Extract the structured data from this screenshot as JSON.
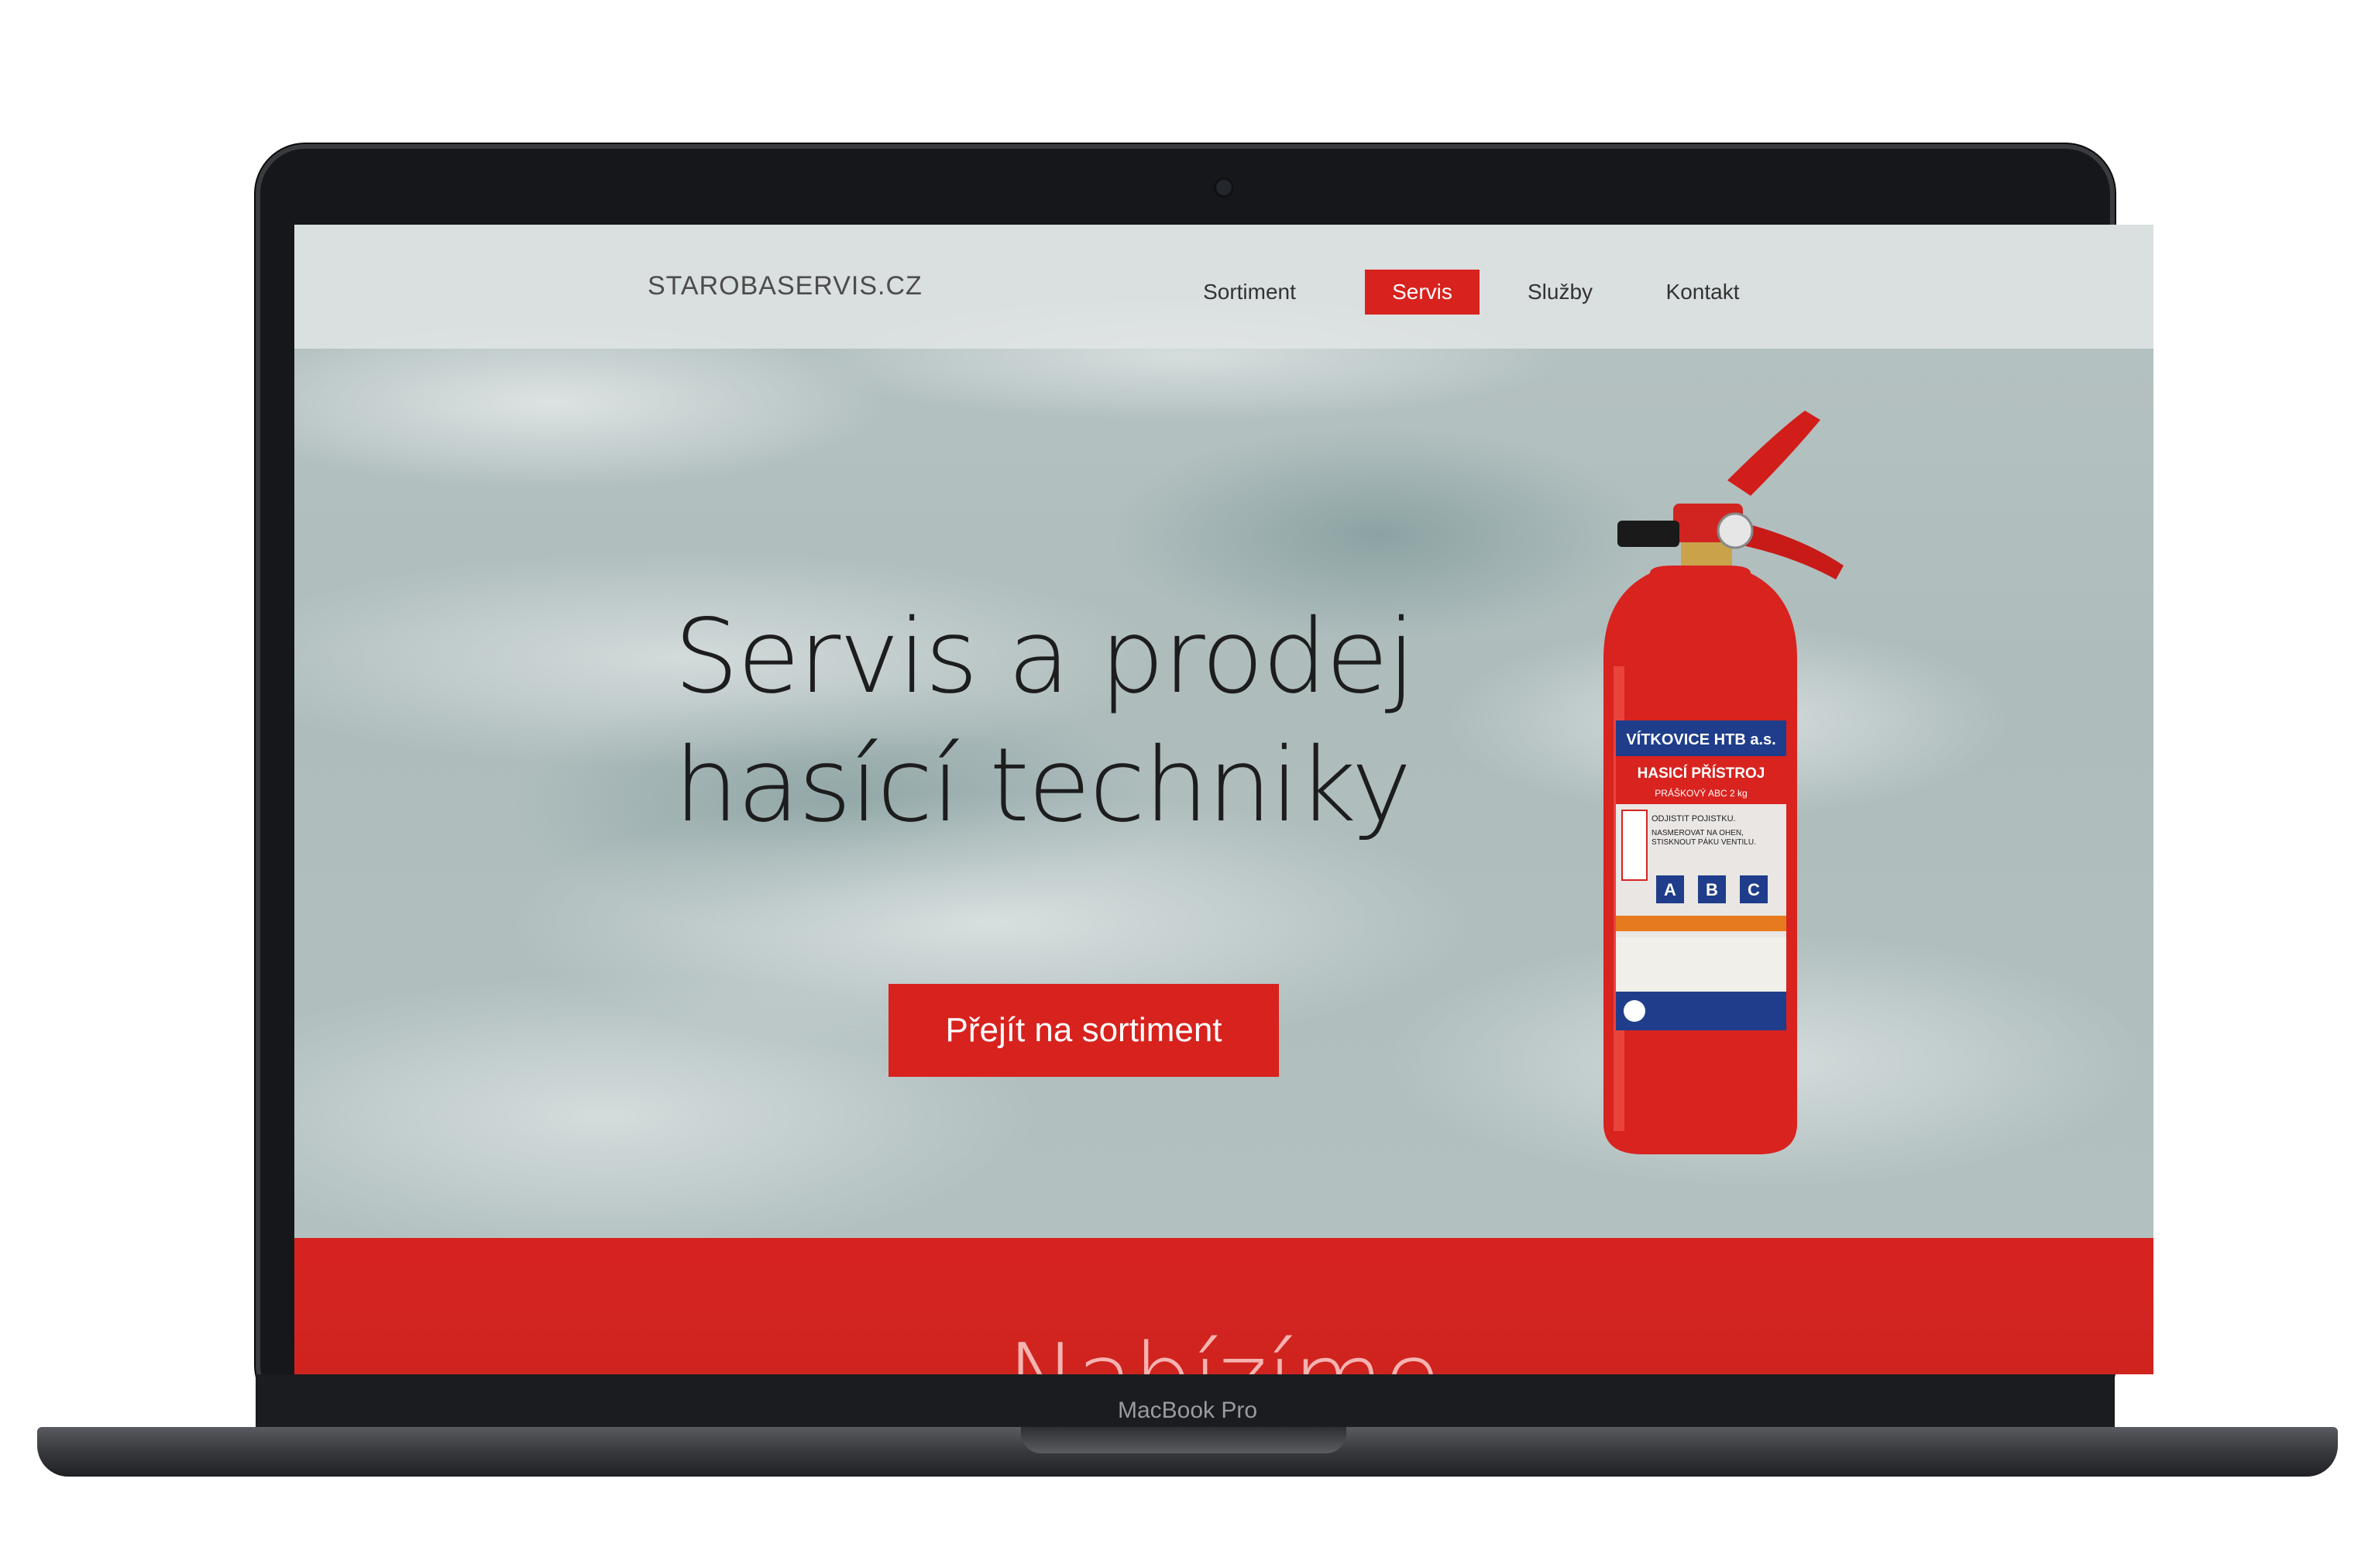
{
  "device": {
    "label": "MacBook Pro"
  },
  "site": {
    "brand": "STAROBASERVIS.CZ",
    "nav": [
      {
        "label": "Sortiment",
        "active": false
      },
      {
        "label": "Servis",
        "active": true
      },
      {
        "label": "Služby",
        "active": false
      },
      {
        "label": "Kontakt",
        "active": false
      }
    ],
    "hero": {
      "title_line1": "Servis a prodej",
      "title_line2": "hasící techniky",
      "cta": "Přejít na sortiment"
    },
    "band": {
      "title": "Nabízíme"
    },
    "product_label": {
      "maker": "VÍTKOVICE HTB a.s.",
      "name": "HASICÍ PŘÍSTROJ",
      "type": "PRÁŠKOVÝ ABC 2 kg",
      "step1": "ODJISTIT POJISTKU.",
      "step2": "NASMĚROVAT NA OHEŇ, STISKNOUT PÁKU VENTILU.",
      "classes": [
        "A",
        "B",
        "C"
      ]
    },
    "colors": {
      "accent": "#d8221e",
      "header_bg": "#e2e5e5",
      "text_dark": "#1d1d1d"
    }
  }
}
